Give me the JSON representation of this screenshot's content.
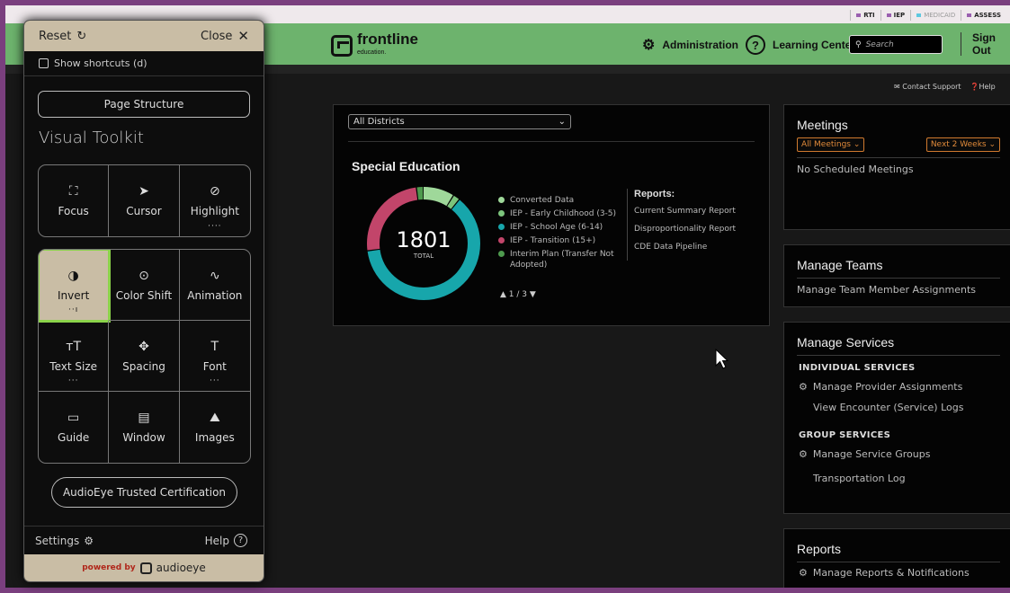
{
  "topstrip": {
    "program_tabs": [
      {
        "label": "RTI",
        "color": "#9a5fb0"
      },
      {
        "label": "IEP",
        "color": "#9a5fb0"
      },
      {
        "label": "MEDICAID",
        "color": "#5ec8e0"
      },
      {
        "label": "ASSESS",
        "color": "#9a5fb0"
      }
    ]
  },
  "header": {
    "logo_word": "frontline",
    "logo_sub": "education.",
    "admin_label": "Administration",
    "learning_label": "Learning Center",
    "search_placeholder": "Search",
    "signout_label": "Sign Out"
  },
  "support": {
    "contact": "Contact Support",
    "help": "Help"
  },
  "main": {
    "district_select": "All Districts",
    "chart_title": "Special Education",
    "pager": "1 / 3",
    "reports_heading": "Reports:",
    "report_links": [
      "Current Summary Report",
      "Disproportionality Report",
      "CDE Data Pipeline"
    ]
  },
  "chart_data": {
    "type": "pie",
    "center_value": "1801",
    "center_label": "TOTAL",
    "series": [
      {
        "name": "Converted Data",
        "color": "#9fd89a"
      },
      {
        "name": "IEP - Early Childhood (3-5)",
        "color": "#7cc47c"
      },
      {
        "name": "IEP - School Age (6-14)",
        "color": "#17a6ab"
      },
      {
        "name": "IEP - Transition (15+)",
        "color": "#c2456a"
      },
      {
        "name": "Interim Plan (Transfer Not Adopted)",
        "color": "#4e9a4e"
      }
    ],
    "slice_fractions": [
      0.09,
      0.02,
      0.62,
      0.25,
      0.02
    ]
  },
  "meetings": {
    "title": "Meetings",
    "filter": "All Meetings",
    "range": "Next 2 Weeks",
    "empty": "No Scheduled Meetings"
  },
  "teams": {
    "title": "Manage Teams",
    "link": "Manage Team Member Assignments"
  },
  "services": {
    "title": "Manage Services",
    "individual_heading": "INDIVIDUAL SERVICES",
    "individual_links": [
      "Manage Provider Assignments",
      "View Encounter (Service) Logs"
    ],
    "group_heading": "GROUP SERVICES",
    "group_links": [
      "Manage Service Groups",
      "Transportation Log"
    ]
  },
  "reports_panel": {
    "title": "Reports",
    "link": "Manage Reports & Notifications"
  },
  "toolkit": {
    "reset": "Reset",
    "close": "Close",
    "shortcuts": "Show shortcuts (d)",
    "page_structure": "Page Structure",
    "title": "Visual Toolkit",
    "tools_a": [
      {
        "label": "Focus",
        "icon": "focus-icon",
        "glyph": "⛶",
        "dots": ""
      },
      {
        "label": "Cursor",
        "icon": "cursor-icon",
        "glyph": "➤",
        "dots": ""
      },
      {
        "label": "Highlight",
        "icon": "link-icon",
        "glyph": "⊘",
        "dots": "····"
      }
    ],
    "tools_b": [
      {
        "label": "Invert",
        "icon": "invert-icon",
        "glyph": "◑",
        "dots": "··ı"
      },
      {
        "label": "Color Shift",
        "icon": "color-shift-icon",
        "glyph": "⊙",
        "dots": ""
      },
      {
        "label": "Animation",
        "icon": "animation-icon",
        "glyph": "∿",
        "dots": ""
      },
      {
        "label": "Text Size",
        "icon": "text-size-icon",
        "glyph": "ᴛT",
        "dots": "···"
      },
      {
        "label": "Spacing",
        "icon": "spacing-icon",
        "glyph": "✥",
        "dots": ""
      },
      {
        "label": "Font",
        "icon": "font-icon",
        "glyph": "T",
        "dots": "···"
      },
      {
        "label": "Guide",
        "icon": "guide-icon",
        "glyph": "▭",
        "dots": ""
      },
      {
        "label": "Window",
        "icon": "window-icon",
        "glyph": "▤",
        "dots": ""
      },
      {
        "label": "Images",
        "icon": "image-icon",
        "glyph": "⛰",
        "dots": ""
      }
    ],
    "certification": "AudioEye Trusted Certification",
    "settings": "Settings",
    "help": "Help",
    "powered_by": "powered by",
    "brand": "audioeye"
  }
}
